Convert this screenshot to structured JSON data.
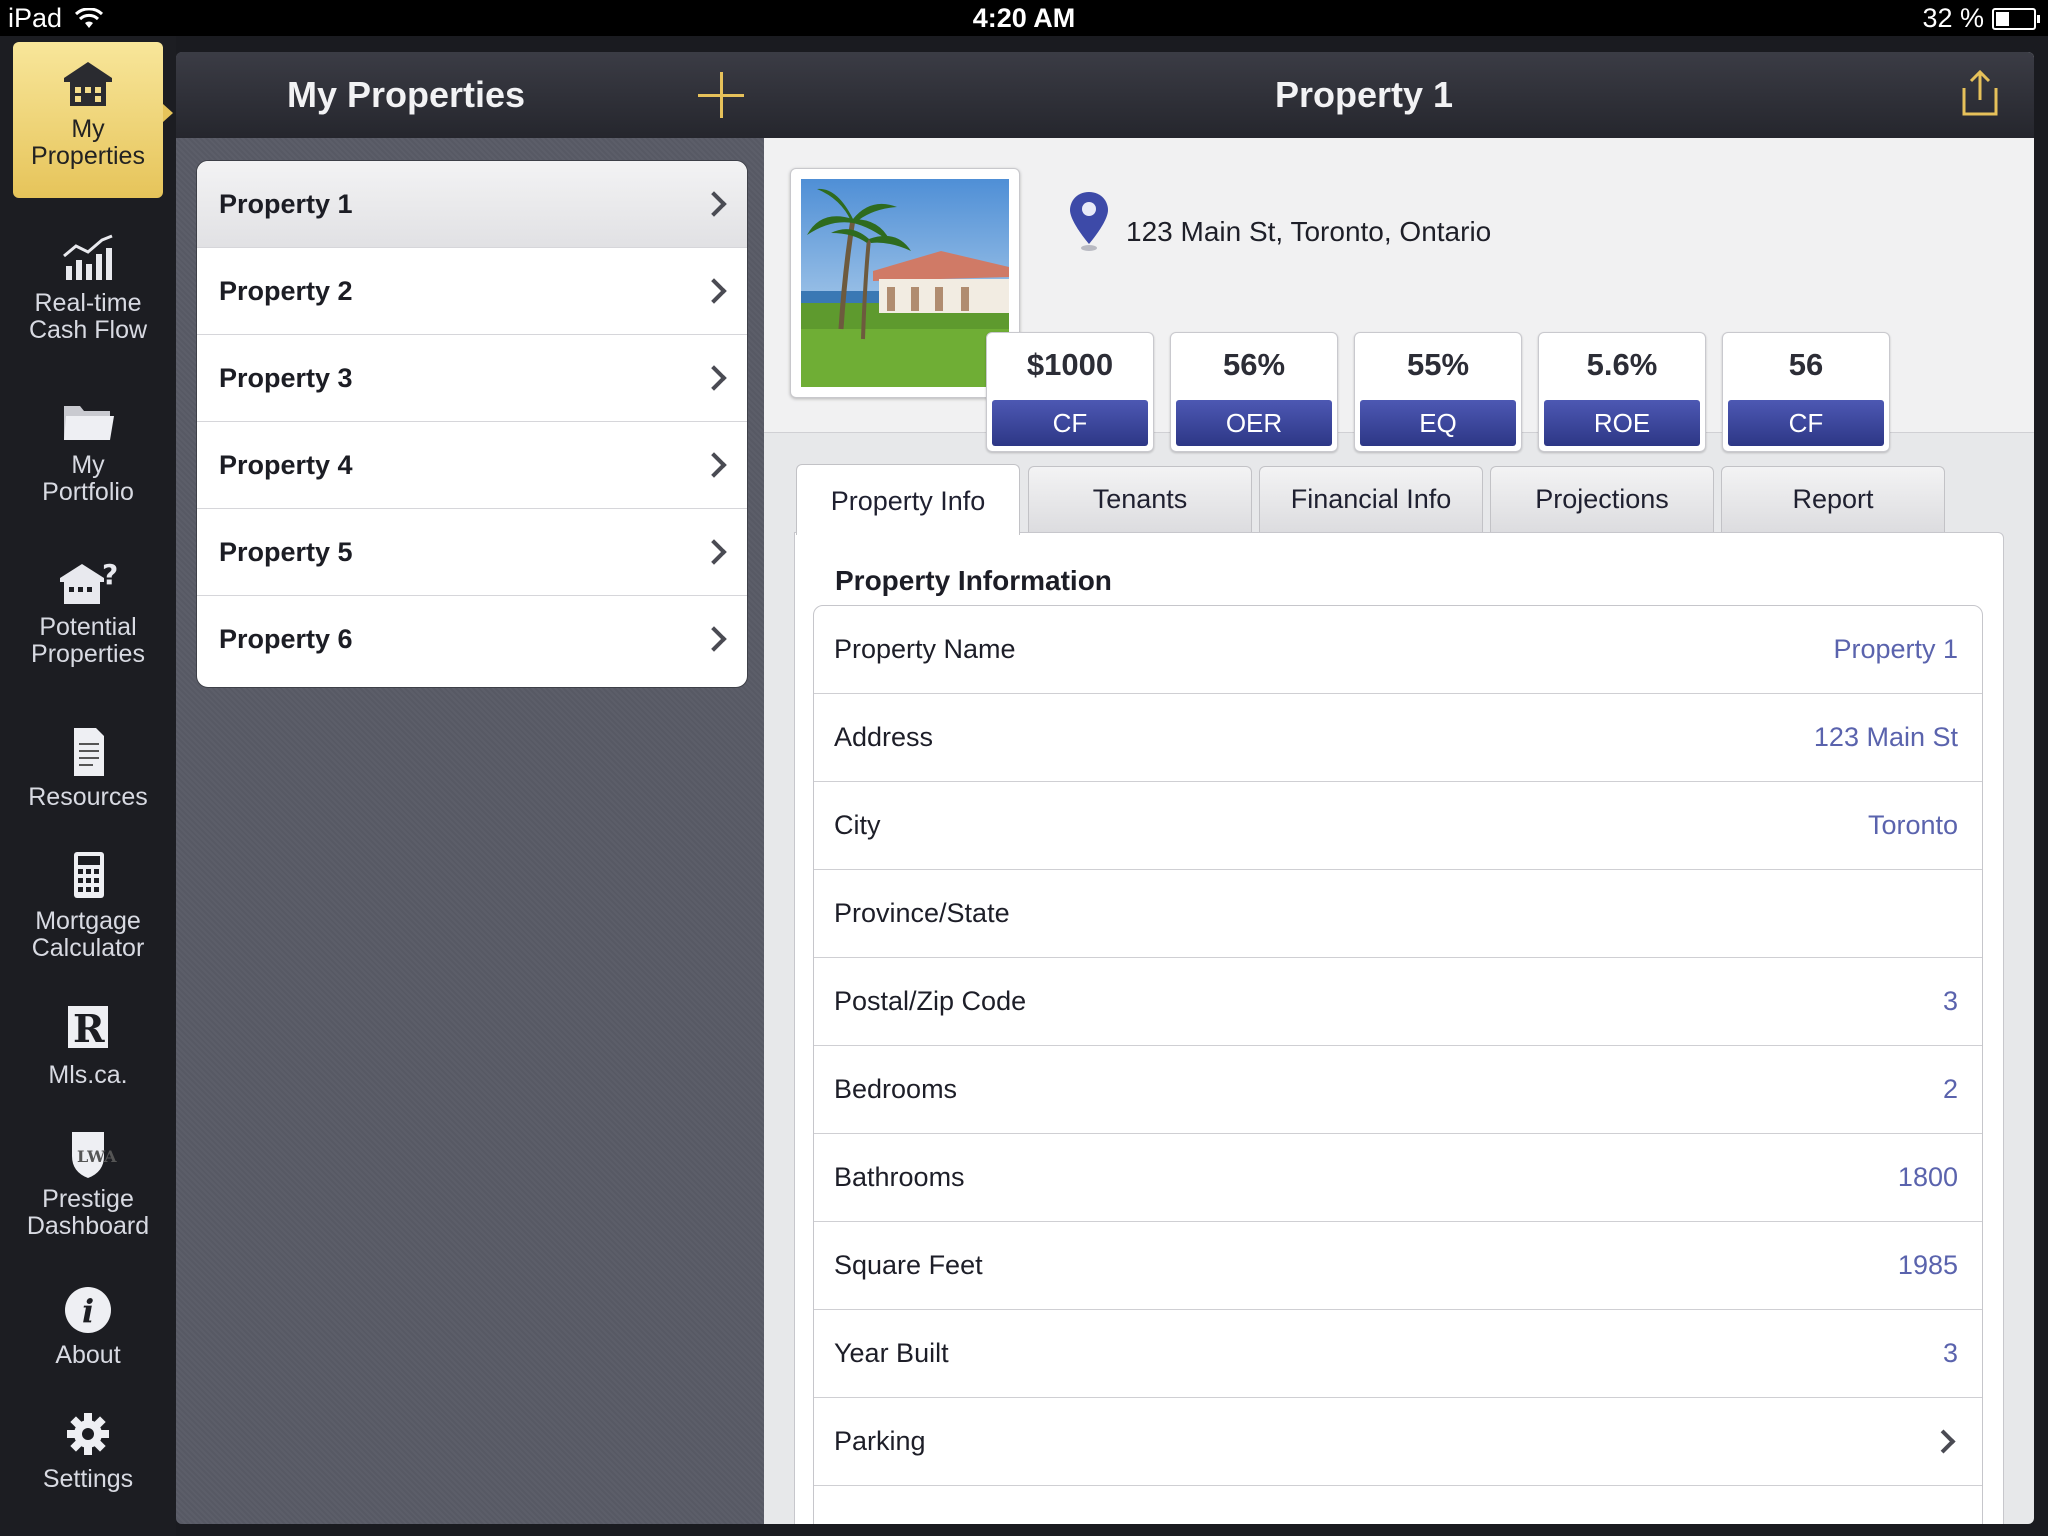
{
  "status": {
    "device": "iPad",
    "time": "4:20 AM",
    "battery": "32 %",
    "battery_level": 0.32
  },
  "dock": {
    "items": [
      {
        "label1": "My",
        "label2": "Properties",
        "icon": "house-icon",
        "active": true
      },
      {
        "label1": "Real-time",
        "label2": "Cash Flow",
        "icon": "chart-icon"
      },
      {
        "label1": "My",
        "label2": "Portfolio",
        "icon": "folder-icon"
      },
      {
        "label1": "Potential",
        "label2": "Properties",
        "icon": "house-question-icon"
      },
      {
        "label1": "Resources",
        "label2": "",
        "icon": "document-icon"
      },
      {
        "label1": "Mortgage",
        "label2": "Calculator",
        "icon": "calculator-icon"
      },
      {
        "label1": "Mls.ca.",
        "label2": "",
        "icon": "realtor-icon"
      },
      {
        "label1": "Prestige",
        "label2": "Dashboard",
        "icon": "shield-icon"
      },
      {
        "label1": "About",
        "label2": "",
        "icon": "info-icon"
      },
      {
        "label1": "Settings",
        "label2": "",
        "icon": "gear-icon"
      }
    ]
  },
  "master": {
    "title": "My Properties",
    "items": [
      "Property 1",
      "Property 2",
      "Property 3",
      "Property 4",
      "Property 5",
      "Property 6"
    ]
  },
  "detail": {
    "title": "Property 1",
    "address": "123 Main St, Toronto, Ontario",
    "stats": [
      {
        "value": "$1000",
        "label": "CF"
      },
      {
        "value": "56%",
        "label": "OER"
      },
      {
        "value": "55%",
        "label": "EQ"
      },
      {
        "value": "5.6%",
        "label": "ROE"
      },
      {
        "value": "56",
        "label": "CF"
      }
    ],
    "tabs": [
      "Property Info",
      "Tenants",
      "Financial Info",
      "Projections",
      "Report"
    ],
    "section_title": "Property Information",
    "rows": [
      {
        "key": "Property Name",
        "value": "Property 1"
      },
      {
        "key": "Address",
        "value": "123 Main St"
      },
      {
        "key": "City",
        "value": "Toronto"
      },
      {
        "key": "Province/State",
        "value": ""
      },
      {
        "key": "Postal/Zip Code",
        "value": "3"
      },
      {
        "key": "Bedrooms",
        "value": "2"
      },
      {
        "key": "Bathrooms",
        "value": "1800"
      },
      {
        "key": "Square Feet",
        "value": "1985"
      },
      {
        "key": "Year Built",
        "value": "3"
      },
      {
        "key": "Parking",
        "value": ""
      }
    ]
  },
  "colors": {
    "accent": "#e6c15a",
    "stat_label": "#3a44a0",
    "value_text": "#5a63ad"
  }
}
